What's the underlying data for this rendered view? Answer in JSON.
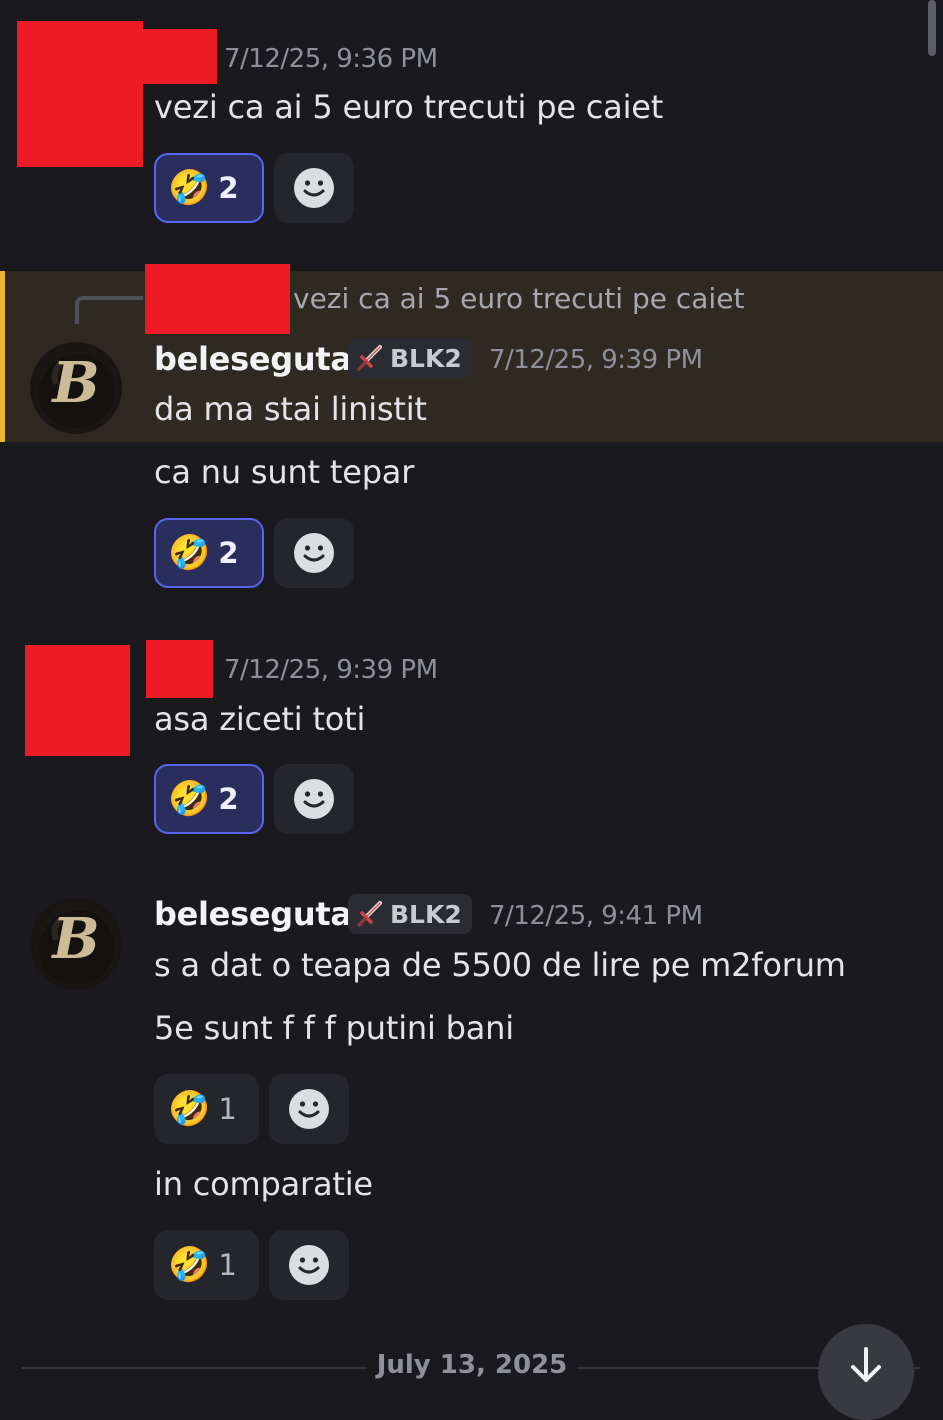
{
  "messages": [
    {
      "timestamp": "7/12/25, 9:36 PM",
      "lines": [
        "vezi ca ai 5 euro trecuti pe caiet"
      ],
      "reactions": [
        {
          "emoji": "🤣",
          "count": "2",
          "active": true
        }
      ]
    },
    {
      "reply_preview": "vezi ca ai 5 euro trecuti pe caiet",
      "username": "beleseguta",
      "role_tag": "BLK2",
      "timestamp": "7/12/25, 9:39 PM",
      "lines": [
        "da ma stai linistit",
        "ca nu sunt tepar"
      ],
      "reactions": [
        {
          "emoji": "🤣",
          "count": "2",
          "active": true
        }
      ]
    },
    {
      "timestamp": "7/12/25, 9:39 PM",
      "lines": [
        "asa ziceti toti"
      ],
      "reactions": [
        {
          "emoji": "🤣",
          "count": "2",
          "active": true
        }
      ]
    },
    {
      "username": "beleseguta",
      "role_tag": "BLK2",
      "timestamp": "7/12/25, 9:41 PM",
      "lines": [
        "s a dat o teapa de 5500 de lire pe m2forum",
        "5e sunt f f f putini bani",
        "in comparatie"
      ],
      "reactions": [
        {
          "emoji": "🤣",
          "count": "1",
          "active": false
        },
        {
          "emoji": "🤣",
          "count": "1",
          "active": false
        }
      ]
    }
  ],
  "date_divider": "July 13, 2025",
  "avatar_letter": "B",
  "icons": {
    "reaction_emoji": "rolling-on-floor-laughing",
    "add_reaction": "smiley-add-reaction-icon",
    "role": "sword-icon",
    "scroll": "arrow-down-icon"
  },
  "colors": {
    "background": "#1a1a1e",
    "highlight": "#2e2a22",
    "highlight_bar": "#f0b232",
    "reaction_active_border": "#5865f2",
    "redaction": "#ed1c24"
  }
}
